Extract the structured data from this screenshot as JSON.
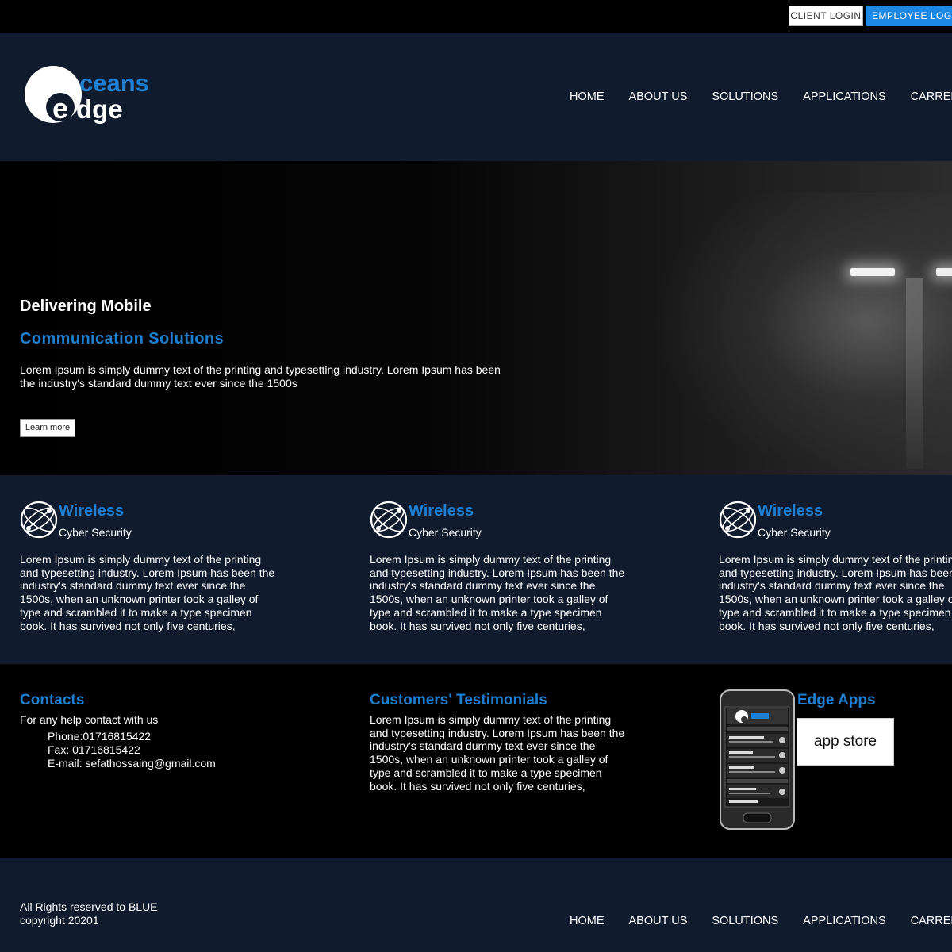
{
  "topbar": {
    "client_login": "CLIENT LOGIN",
    "employee_login": "EMPLOYEE LOGIN"
  },
  "logo": {
    "part1": "ceans",
    "part2": "dge"
  },
  "nav": {
    "items": [
      "HOME",
      "ABOUT US",
      "SOLUTIONS",
      "APPLICATIONS",
      "CARRER"
    ]
  },
  "hero": {
    "title": "Delivering Mobile",
    "subtitle": "Communication Solutions",
    "text": "Lorem Ipsum is simply dummy text of the printing and typesetting industry. Lorem Ipsum has been the industry's standard dummy text ever since the 1500s",
    "button": "Learn more"
  },
  "features": [
    {
      "title": "Wireless",
      "subtitle": "Cyber Security",
      "text": "Lorem Ipsum is simply dummy text of the printing and typesetting industry. Lorem Ipsum has been the industry's standard dummy text ever since the 1500s, when an unknown printer took a galley of type and scrambled it to make a type specimen book. It has survived not only five centuries,"
    },
    {
      "title": "Wireless",
      "subtitle": "Cyber Security",
      "text": "Lorem Ipsum is simply dummy text of the printing and typesetting industry. Lorem Ipsum has been the industry's standard dummy text ever since the 1500s, when an unknown printer took a galley of type and scrambled it to make a type specimen book. It has survived not only five centuries,"
    },
    {
      "title": "Wireless",
      "subtitle": "Cyber Security",
      "text": "Lorem Ipsum is simply dummy text of the printing and typesetting industry. Lorem Ipsum has been the industry's standard dummy text ever since the 1500s, when an unknown printer took a galley of type and scrambled it to make a type specimen book. It has survived not only five centuries,"
    }
  ],
  "contacts": {
    "title": "Contacts",
    "intro": "For any help contact with us",
    "phone": "Phone:01716815422",
    "fax": "Fax: 01716815422",
    "email": "E-mail: sefathossaing@gmail.com"
  },
  "testimonials": {
    "title": "Customers' Testimonials",
    "text": "Lorem Ipsum is simply dummy text of the printing and typesetting industry. Lorem Ipsum has been the industry's standard dummy text ever since the 1500s, when an unknown printer took a galley of type and scrambled it to make a type specimen book. It has survived not only five centuries,"
  },
  "apps": {
    "title": "Edge Apps",
    "button": "app store"
  },
  "footer": {
    "rights_line1": "All Rights reserved to BLUE",
    "rights_line2": "copyright 20201",
    "nav": [
      "HOME",
      "ABOUT US",
      "SOLUTIONS",
      "APPLICATIONS",
      "CARRER"
    ]
  },
  "colors": {
    "navy": "#101b2e",
    "accent_blue": "#1e7fd0",
    "button_blue": "#1e88e5",
    "black": "#000000"
  }
}
